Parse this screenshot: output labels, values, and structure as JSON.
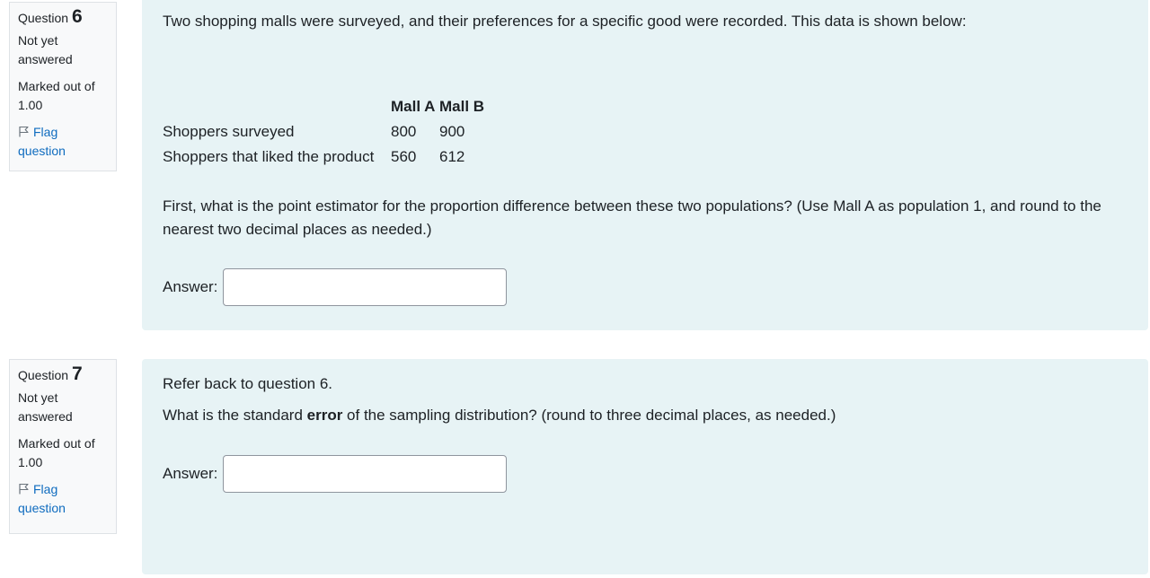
{
  "q6": {
    "info": {
      "question_label": "Question",
      "number": "6",
      "state": "Not yet answered",
      "grade": "Marked out of 1.00",
      "flag_label": "Flag question"
    },
    "intro": "Two shopping malls were surveyed, and their preferences for a specific good were recorded. This data is shown below:",
    "table": {
      "columns": [
        "Mall A",
        "Mall B"
      ],
      "rows": [
        {
          "label": "Shoppers surveyed",
          "values": [
            "800",
            "900"
          ]
        },
        {
          "label": "Shoppers that liked the product",
          "values": [
            "560",
            "612"
          ]
        }
      ]
    },
    "question": "First, what is the point estimator for the proportion difference between these two populations? (Use Mall A as population 1, and round to the nearest two decimal places as needed.)",
    "answer_label": "Answer:",
    "answer_value": ""
  },
  "q7": {
    "info": {
      "question_label": "Question",
      "number": "7",
      "state": "Not yet answered",
      "grade": "Marked out of 1.00",
      "flag_label": "Flag question"
    },
    "line1": "Refer back to question 6.",
    "line2_before": "What is the standard ",
    "line2_bold": "error",
    "line2_after": " of the sampling distribution? (round to three decimal places, as needed.)",
    "answer_label": "Answer:",
    "answer_value": ""
  }
}
